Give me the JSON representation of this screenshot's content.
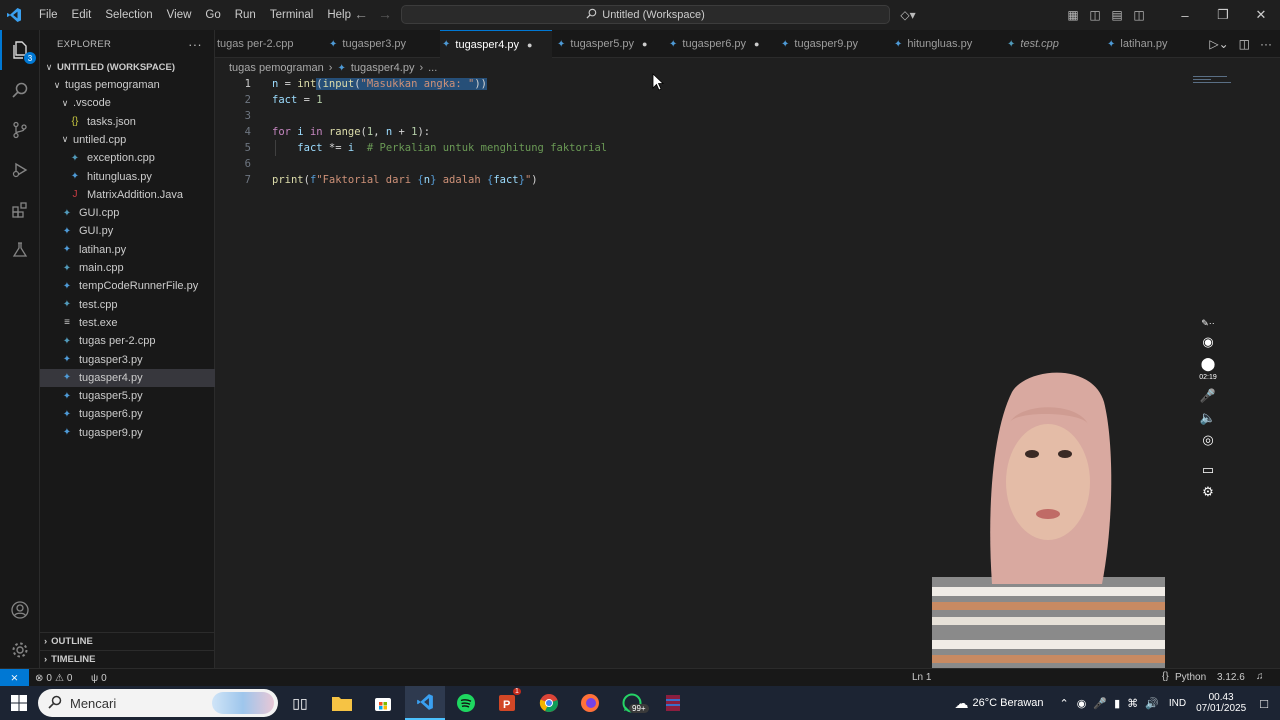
{
  "menu": [
    "File",
    "Edit",
    "Selection",
    "View",
    "Go",
    "Run",
    "Terminal",
    "Help"
  ],
  "command_center": "Untitled (Workspace)",
  "explorer": {
    "title": "EXPLORER",
    "workspace": "UNTITLED (WORKSPACE)",
    "activity_badge": "3",
    "items": [
      {
        "label": "tugas pemograman",
        "depth": 1,
        "kind": "folder-open"
      },
      {
        "label": ".vscode",
        "depth": 2,
        "kind": "folder-open"
      },
      {
        "label": "tasks.json",
        "depth": 3,
        "kind": "json"
      },
      {
        "label": "untiled.cpp",
        "depth": 2,
        "kind": "folder-open"
      },
      {
        "label": "exception.cpp",
        "depth": 3,
        "kind": "cpp"
      },
      {
        "label": "hitungluas.py",
        "depth": 3,
        "kind": "py"
      },
      {
        "label": "MatrixAddition.Java",
        "depth": 3,
        "kind": "java"
      },
      {
        "label": "GUI.cpp",
        "depth": 2,
        "kind": "cpp"
      },
      {
        "label": "GUI.py",
        "depth": 2,
        "kind": "py"
      },
      {
        "label": "latihan.py",
        "depth": 2,
        "kind": "py"
      },
      {
        "label": "main.cpp",
        "depth": 2,
        "kind": "cpp"
      },
      {
        "label": "tempCodeRunnerFile.py",
        "depth": 2,
        "kind": "py"
      },
      {
        "label": "test.cpp",
        "depth": 2,
        "kind": "cpp"
      },
      {
        "label": "test.exe",
        "depth": 2,
        "kind": "exe"
      },
      {
        "label": "tugas per-2.cpp",
        "depth": 2,
        "kind": "cpp"
      },
      {
        "label": "tugasper3.py",
        "depth": 2,
        "kind": "py"
      },
      {
        "label": "tugasper4.py",
        "depth": 2,
        "kind": "py",
        "selected": true
      },
      {
        "label": "tugasper5.py",
        "depth": 2,
        "kind": "py"
      },
      {
        "label": "tugasper6.py",
        "depth": 2,
        "kind": "py"
      },
      {
        "label": "tugasper9.py",
        "depth": 2,
        "kind": "py"
      }
    ],
    "outline": "OUTLINE",
    "timeline": "TIMELINE"
  },
  "tabs": [
    {
      "label": "tugas per-2.cpp",
      "kind": "cpp"
    },
    {
      "label": "tugasper3.py",
      "kind": "py"
    },
    {
      "label": "tugasper4.py",
      "kind": "py",
      "active": true,
      "dirty": true
    },
    {
      "label": "tugasper5.py",
      "kind": "py",
      "dirty": true
    },
    {
      "label": "tugasper6.py",
      "kind": "py",
      "dirty": true
    },
    {
      "label": "tugasper9.py",
      "kind": "py"
    },
    {
      "label": "hitungluas.py",
      "kind": "py"
    },
    {
      "label": "test.cpp",
      "kind": "cpp",
      "italic": true
    },
    {
      "label": "latihan.py",
      "kind": "py"
    }
  ],
  "breadcrumb": {
    "folder": "tugas pemograman",
    "file": "tugasper4.py",
    "more": "..."
  },
  "code_lines": [
    {
      "n": "1",
      "text": "n = int(input(\"Masukkan angka: \"))"
    },
    {
      "n": "2",
      "text": "fact = 1"
    },
    {
      "n": "3",
      "text": ""
    },
    {
      "n": "4",
      "text": "for i in range(1, n + 1):"
    },
    {
      "n": "5",
      "text": "    fact *= i  # Perkalian untuk menghitung faktorial"
    },
    {
      "n": "6",
      "text": ""
    },
    {
      "n": "7",
      "text": "print(f\"Faktorial dari {n} adalah {fact}\")"
    }
  ],
  "status": {
    "errors": "0",
    "warnings": "0",
    "ports": "0",
    "position": "Ln 1",
    "language": "Python",
    "version": "3.12.6"
  },
  "recorder": {
    "timer": "02:19"
  },
  "taskbar": {
    "search_placeholder": "Mencari",
    "whatsapp_badge": "99+",
    "ppt_badge": "1",
    "weather": "26°C Berawan",
    "lang": "IND",
    "time": "00.43",
    "date": "07/01/2025"
  },
  "colors": {
    "accent": "#0078d4",
    "editor_bg": "#1f1f1f",
    "selection": "#264f78"
  }
}
